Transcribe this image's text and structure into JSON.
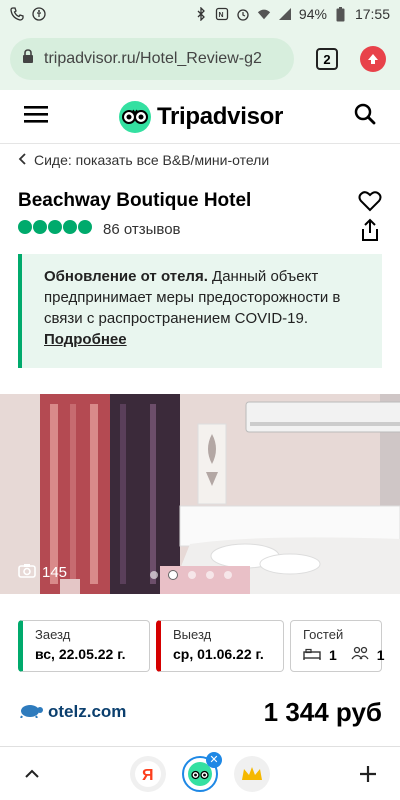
{
  "status_bar": {
    "battery": "94%",
    "time": "17:55"
  },
  "browser": {
    "url": "tripadvisor.ru/Hotel_Review-g2",
    "tab_count": "2"
  },
  "header": {
    "brand": "Tripadvisor"
  },
  "breadcrumb": {
    "text": "Сиде: показать все B&B/мини-отели"
  },
  "hotel": {
    "name": "Beachway Boutique Hotel",
    "rating_bubbles": 5,
    "reviews": "86 отзывов"
  },
  "update": {
    "title": "Обновление от отеля.",
    "text": "Данный объект предпринимает меры предосторожности в связи с распространением COVID-19.",
    "link": "Подробнее"
  },
  "photo": {
    "count": "145",
    "dots": 5,
    "active_dot": 2
  },
  "booking": {
    "checkin_label": "Заезд",
    "checkin_value": "вс, 22.05.22 г.",
    "checkout_label": "Выезд",
    "checkout_value": "ср, 01.06.22 г.",
    "guests_label": "Гостей",
    "rooms": "1",
    "guests": "1"
  },
  "price": {
    "provider": "otelz.com",
    "amount": "1 344 руб"
  },
  "colors": {
    "brand_green": "#00aa6c",
    "checkout_red": "#d50000",
    "accent_blue": "#1e88e5"
  }
}
